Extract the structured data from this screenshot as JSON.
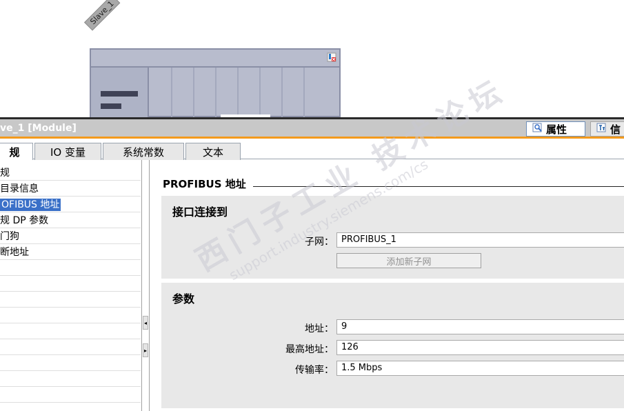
{
  "device": {
    "label": "Slave_1"
  },
  "inspector": {
    "title": "ve_1 [Module]",
    "header_tabs": [
      {
        "label": "属性",
        "icon": "properties-icon",
        "active": true
      },
      {
        "label": "信",
        "icon": "info-icon",
        "active": false
      }
    ],
    "tabs": [
      {
        "label": "规",
        "active": true
      },
      {
        "label": "IO 变量",
        "active": false
      },
      {
        "label": "系统常数",
        "active": false
      },
      {
        "label": "文本",
        "active": false
      }
    ],
    "nav": {
      "items": [
        {
          "label": "规"
        },
        {
          "label": " 目录信息"
        },
        {
          "label": "OFIBUS 地址",
          "selected": true
        },
        {
          "label": "规 DP 参数"
        },
        {
          "label": "门狗"
        },
        {
          "label": "断地址"
        }
      ]
    },
    "content": {
      "section_title": "PROFIBUS 地址",
      "interface_group": {
        "title": "接口连接到",
        "subnet_label": "子网：",
        "subnet_value": "PROFIBUS_1",
        "add_subnet_button": "添加新子网"
      },
      "params_group": {
        "title": "参数",
        "address_label": "地址：",
        "address_value": "9",
        "highest_label": "最高地址：",
        "highest_value": "126",
        "rate_label": "传输率：",
        "rate_value": "1.5 Mbps"
      }
    }
  },
  "watermark": {
    "text_cn": "西门子工业 技术论坛",
    "text_url": "support.industry.siemens.com/cs"
  },
  "colors": {
    "accent_orange": "#f39a1c",
    "selection_blue": "#3a70c8",
    "module_fill": "#b8bccd",
    "group_bg": "#e8e8e8"
  }
}
